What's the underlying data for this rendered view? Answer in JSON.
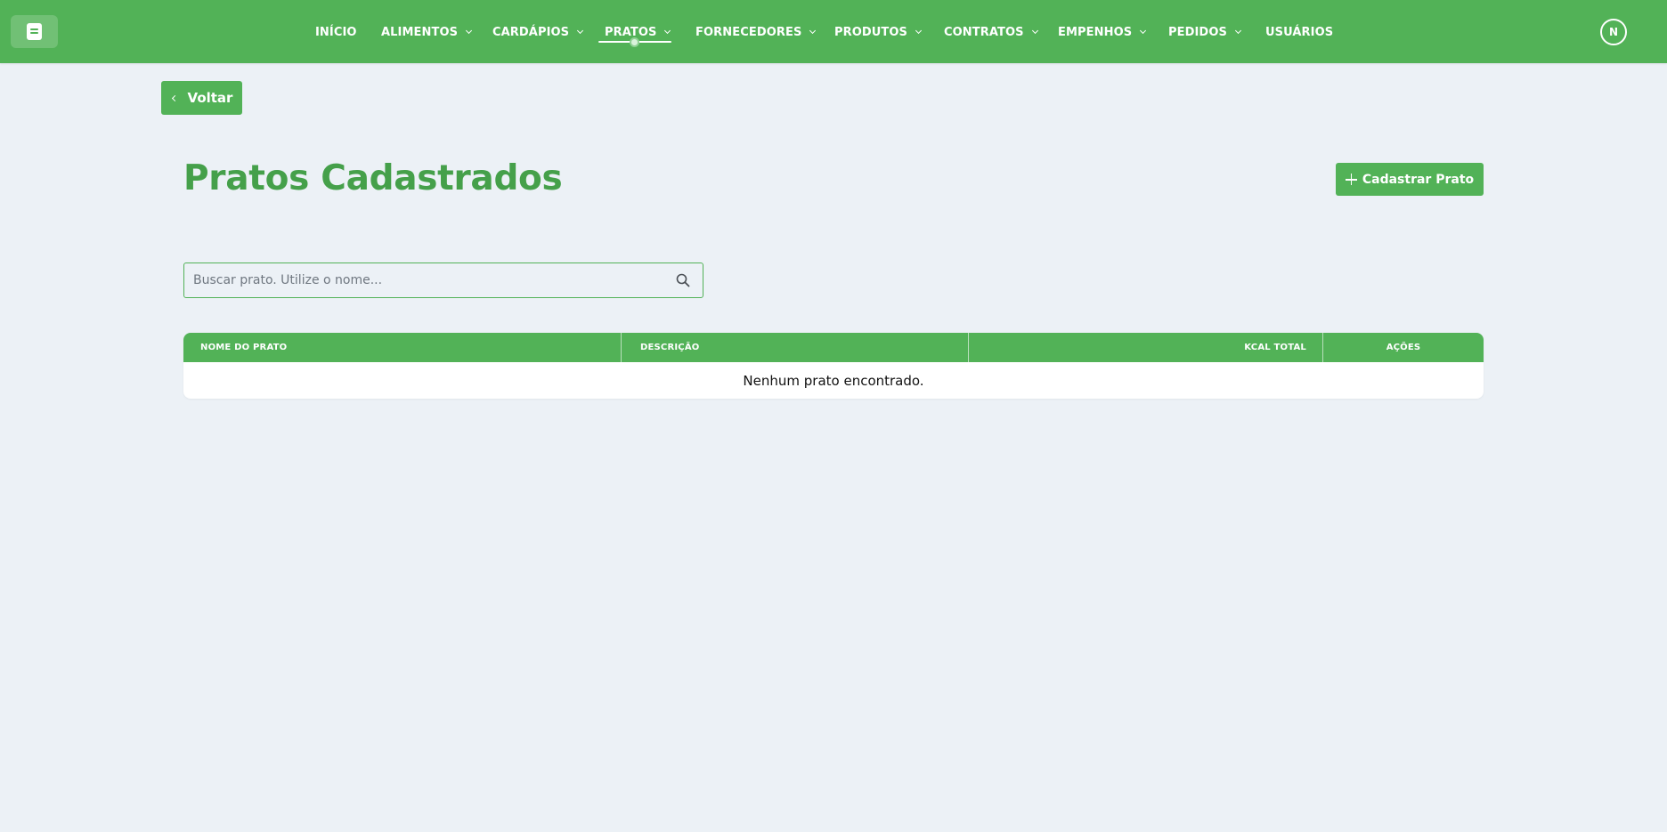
{
  "topbar": {
    "logo_icon": "book-icon",
    "nav": [
      {
        "label": "INÍCIO",
        "has_dropdown": false
      },
      {
        "label": "ALIMENTOS",
        "has_dropdown": true
      },
      {
        "label": "CARDÁPIOS",
        "has_dropdown": true
      },
      {
        "label": "PRATOS",
        "has_dropdown": true,
        "active": true
      },
      {
        "label": "FORNECEDORES",
        "has_dropdown": true
      },
      {
        "label": "PRODUTOS",
        "has_dropdown": true
      },
      {
        "label": "CONTRATOS",
        "has_dropdown": true
      },
      {
        "label": "EMPENHOS",
        "has_dropdown": true
      },
      {
        "label": "PEDIDOS",
        "has_dropdown": true
      },
      {
        "label": "USUÁRIOS",
        "has_dropdown": false
      }
    ],
    "avatar_initial": "N"
  },
  "back_button": {
    "label": "Voltar"
  },
  "page": {
    "title": "Pratos Cadastrados",
    "add_button_label": "Cadastrar Prato"
  },
  "search": {
    "placeholder": "Buscar prato. Utilize o nome...",
    "value": ""
  },
  "table": {
    "columns": [
      "NOME DO PRATO",
      "DESCRIÇÃO",
      "KCAL TOTAL",
      "AÇÕES"
    ],
    "empty_message": "Nenhum prato encontrado."
  },
  "colors": {
    "primary": "#52b257",
    "title": "#45a04a",
    "background": "#ecf1f6"
  }
}
